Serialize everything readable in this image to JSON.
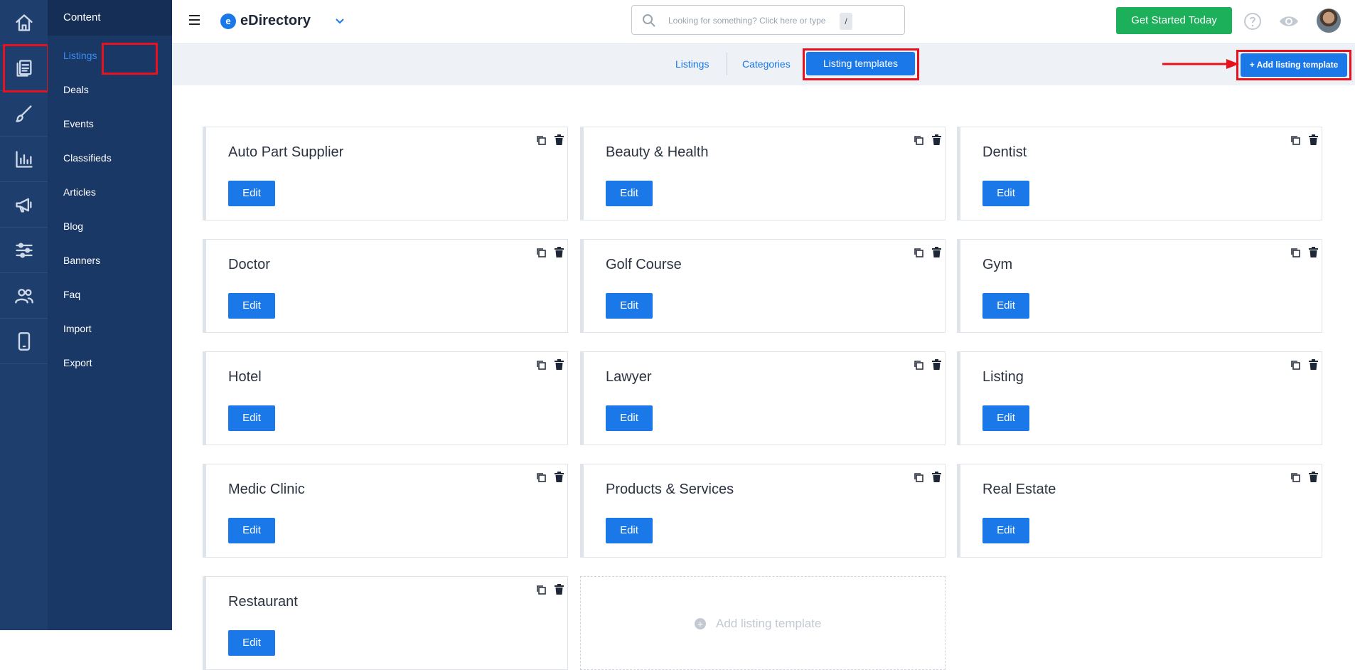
{
  "rail": {
    "items": [
      "home-icon",
      "content-icon",
      "brush-icon",
      "chart-icon",
      "megaphone-icon",
      "sliders-icon",
      "users-icon",
      "mobile-icon"
    ]
  },
  "subnav": {
    "header": "Content",
    "items": [
      {
        "label": "Listings",
        "active": true
      },
      {
        "label": "Deals"
      },
      {
        "label": "Events"
      },
      {
        "label": "Classifieds"
      },
      {
        "label": "Articles"
      },
      {
        "label": "Blog"
      },
      {
        "label": "Banners"
      },
      {
        "label": "Faq"
      },
      {
        "label": "Import"
      },
      {
        "label": "Export"
      }
    ]
  },
  "topbar": {
    "brand_logo": "e",
    "brand": "eDirectory",
    "search_placeholder": "Looking for something? Click here or type",
    "search_key": "/",
    "cta": "Get Started Today"
  },
  "tabs": {
    "items": [
      "Listings",
      "Categories"
    ],
    "active": "Listing templates",
    "add_button": "+ Add listing template"
  },
  "templates": [
    "Auto Part Supplier",
    "Beauty & Health",
    "Dentist",
    "Doctor",
    "Golf Course",
    "Gym",
    "Hotel",
    "Lawyer",
    "Listing",
    "Medic Clinic",
    "Products & Services",
    "Real Estate",
    "Restaurant"
  ],
  "edit_label": "Edit",
  "add_card_label": "Add listing template",
  "colors": {
    "primary": "#1a78e8",
    "cta": "#1db05a",
    "sidebar": "#193866",
    "rail": "#1e3e6e",
    "highlight": "#e8121f"
  }
}
